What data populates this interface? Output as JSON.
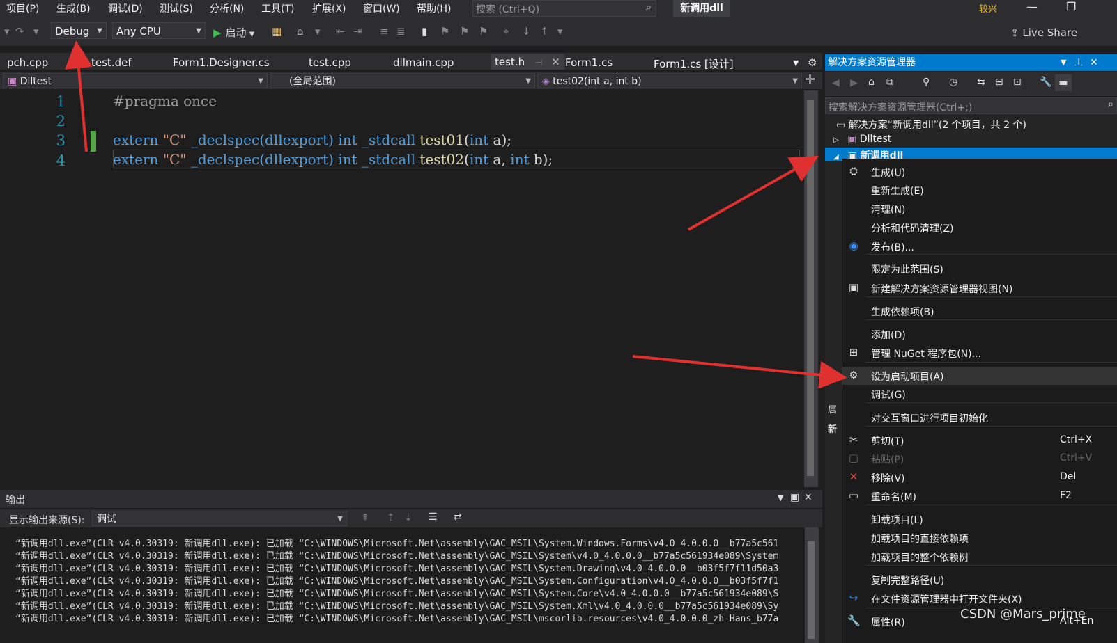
{
  "menu": [
    "项目(P)",
    "生成(B)",
    "调试(D)",
    "测试(S)",
    "分析(N)",
    "工具(T)",
    "扩展(X)",
    "窗口(W)",
    "帮助(H)"
  ],
  "search": {
    "placeholder": "搜索 (Ctrl+Q)"
  },
  "app_title": "新调用dll",
  "user_badge": "较兴",
  "toolbar": {
    "config": "Debug",
    "platform": "Any CPU",
    "start": "启动",
    "live_share": "Live Share"
  },
  "tabs": [
    "pch.cpp",
    "test.def",
    "Form1.Designer.cs",
    "test.cpp",
    "dllmain.cpp",
    "test.h",
    "Form1.cs",
    "Form1.cs [设计]"
  ],
  "navbar": {
    "project": "Dlltest",
    "scope": "(全局范围)",
    "member": "test02(int a, int b)"
  },
  "editor": {
    "line_numbers": [
      "1",
      "2",
      "3",
      "4"
    ],
    "line1": "#pragma once",
    "tok": {
      "extern": "extern",
      "c_str": "\"C\"",
      "declspec": "_declspec",
      "dllexport": "(dllexport)",
      "int": "int",
      "stdcall": "_stdcall",
      "test01": "test01",
      "test02": "test02",
      "open": "(",
      "a": "a",
      "a_comma": "a,",
      "b": "b",
      "close": ");"
    }
  },
  "output": {
    "title": "输出",
    "source_label": "显示输出来源(S):",
    "source_value": "调试",
    "lines": [
      "“新调用dll.exe”(CLR v4.0.30319: 新调用dll.exe): 已加载 “C:\\WINDOWS\\Microsoft.Net\\assembly\\GAC_MSIL\\System.Windows.Forms\\v4.0_4.0.0.0__b77a5c561",
      "“新调用dll.exe”(CLR v4.0.30319: 新调用dll.exe): 已加载 “C:\\WINDOWS\\Microsoft.Net\\assembly\\GAC_MSIL\\System\\v4.0_4.0.0.0__b77a5c561934e089\\System",
      "“新调用dll.exe”(CLR v4.0.30319: 新调用dll.exe): 已加载 “C:\\WINDOWS\\Microsoft.Net\\assembly\\GAC_MSIL\\System.Drawing\\v4.0_4.0.0.0__b03f5f7f11d50a3",
      "“新调用dll.exe”(CLR v4.0.30319: 新调用dll.exe): 已加载 “C:\\WINDOWS\\Microsoft.Net\\assembly\\GAC_MSIL\\System.Configuration\\v4.0_4.0.0.0__b03f5f7f1",
      "“新调用dll.exe”(CLR v4.0.30319: 新调用dll.exe): 已加载 “C:\\WINDOWS\\Microsoft.Net\\assembly\\GAC_MSIL\\System.Core\\v4.0_4.0.0.0__b77a5c561934e089\\S",
      "“新调用dll.exe”(CLR v4.0.30319: 新调用dll.exe): 已加载 “C:\\WINDOWS\\Microsoft.Net\\assembly\\GAC_MSIL\\System.Xml\\v4.0_4.0.0.0__b77a5c561934e089\\Sy",
      "“新调用dll.exe”(CLR v4.0.30319: 新调用dll.exe): 已加载 “C:\\WINDOWS\\Microsoft.Net\\assembly\\GAC_MSIL\\mscorlib.resources\\v4.0_4.0.0.0_zh-Hans_b77a"
    ]
  },
  "solution": {
    "title": "解决方案资源管理器",
    "search_placeholder": "搜索解决方案资源管理器(Ctrl+;)",
    "root": "解决方案“新调用dll”(2 个项目，共 2 个)",
    "project1": "Dlltest",
    "project2": "新调用dll"
  },
  "props_fragment": {
    "a": "属",
    "b": "新"
  },
  "context_menu": [
    {
      "icon": "build-icon",
      "glyph": "⛭",
      "label": "生成(U)",
      "shortcut": ""
    },
    {
      "icon": "",
      "glyph": "",
      "label": "重新生成(E)",
      "shortcut": ""
    },
    {
      "icon": "",
      "glyph": "",
      "label": "清理(N)",
      "shortcut": ""
    },
    {
      "icon": "",
      "glyph": "",
      "label": "分析和代码清理(Z)",
      "shortcut": ""
    },
    {
      "icon": "globe-icon",
      "glyph": "◉",
      "label": "发布(B)...",
      "shortcut": ""
    },
    {
      "icon": "",
      "glyph": "",
      "label": "限定为此范围(S)",
      "shortcut": ""
    },
    {
      "icon": "new-view-icon",
      "glyph": "▣",
      "label": "新建解决方案资源管理器视图(N)",
      "shortcut": ""
    },
    {
      "icon": "",
      "glyph": "",
      "label": "生成依赖项(B)",
      "shortcut": ""
    },
    {
      "icon": "",
      "glyph": "",
      "label": "添加(D)",
      "shortcut": ""
    },
    {
      "icon": "nuget-icon",
      "glyph": "⊞",
      "label": "管理 NuGet 程序包(N)...",
      "shortcut": ""
    },
    {
      "icon": "gear-icon",
      "glyph": "⚙",
      "label": "设为启动项目(A)",
      "shortcut": ""
    },
    {
      "icon": "",
      "glyph": "",
      "label": "调试(G)",
      "shortcut": ""
    },
    {
      "icon": "",
      "glyph": "",
      "label": "对交互窗口进行项目初始化",
      "shortcut": ""
    },
    {
      "icon": "cut-icon",
      "glyph": "✂",
      "label": "剪切(T)",
      "shortcut": "Ctrl+X"
    },
    {
      "icon": "paste-icon",
      "glyph": "▢",
      "label": "粘贴(P)",
      "shortcut": "Ctrl+V"
    },
    {
      "icon": "remove-icon",
      "glyph": "✕",
      "label": "移除(V)",
      "shortcut": "Del"
    },
    {
      "icon": "rename-icon",
      "glyph": "▭",
      "label": "重命名(M)",
      "shortcut": "F2"
    },
    {
      "icon": "",
      "glyph": "",
      "label": "卸载项目(L)",
      "shortcut": ""
    },
    {
      "icon": "",
      "glyph": "",
      "label": "加载项目的直接依赖项",
      "shortcut": ""
    },
    {
      "icon": "",
      "glyph": "",
      "label": "加载项目的整个依赖树",
      "shortcut": ""
    },
    {
      "icon": "",
      "glyph": "",
      "label": "复制完整路径(U)",
      "shortcut": ""
    },
    {
      "icon": "open-folder-icon",
      "glyph": "↪",
      "label": "在文件资源管理器中打开文件夹(X)",
      "shortcut": ""
    },
    {
      "icon": "wrench-icon",
      "glyph": "🔧",
      "label": "属性(R)",
      "shortcut": "Alt+En"
    }
  ],
  "watermark": "CSDN @Mars_prime",
  "colors": {
    "accent": "#007acc",
    "annotation_arrow": "#e03030",
    "keyword": "#569cd6",
    "string": "#d69d85",
    "function": "#dcdcaa"
  }
}
